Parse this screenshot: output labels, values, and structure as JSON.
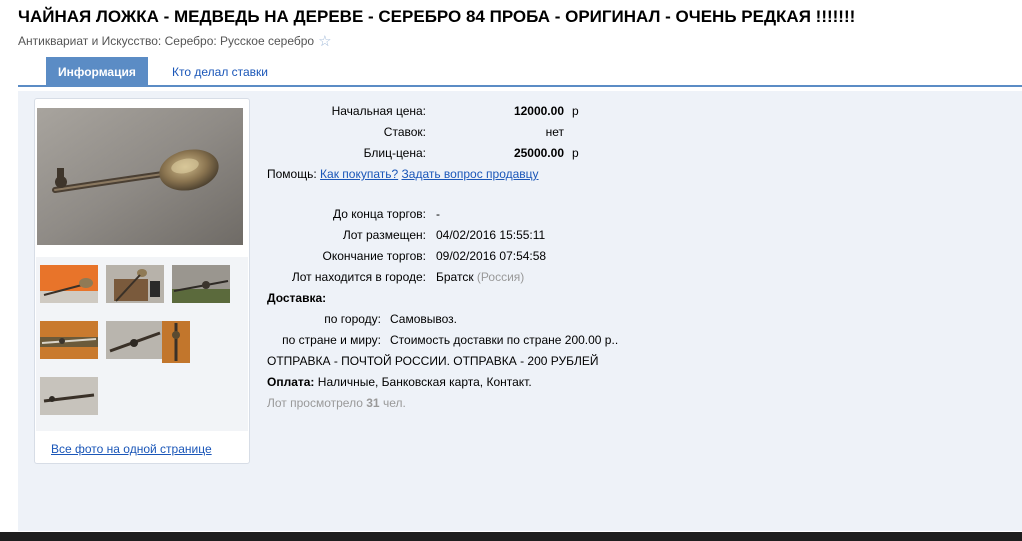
{
  "title": "ЧАЙНАЯ ЛОЖКА - МЕДВЕДЬ НА ДЕРЕВЕ - СЕРЕБРО 84 ПРОБА - ОРИГИНАЛ - ОЧЕНЬ РЕДКАЯ !!!!!!!",
  "breadcrumb": "Антиквариат и Искусство: Серебро: Русское серебро",
  "tabs": [
    {
      "label": "Информация",
      "active": true
    },
    {
      "label": "Кто делал ставки",
      "active": false
    }
  ],
  "lot": {
    "start_price_label": "Начальная цена:",
    "start_price_value": "12000.00",
    "start_price_unit": "р",
    "bids_label": "Ставок:",
    "bids_value": "нет",
    "blitz_label": "Блиц-цена:",
    "blitz_value": "25000.00",
    "blitz_unit": "р",
    "help_label": "Помощь:",
    "help_link_1": "Как покупать?",
    "help_link_2": "Задать вопрос продавцу",
    "time_left_label": "До конца торгов:",
    "time_left_value": "-",
    "posted_label": "Лот размещен:",
    "posted_value": "04/02/2016 15:55:11",
    "end_label": "Окончание торгов:",
    "end_value": "09/02/2016 07:54:58",
    "city_label": "Лот находится в городе:",
    "city_value": "Братск",
    "country_value": "(Россия)",
    "delivery_heading": "Доставка:",
    "delivery_city_label": "по городу:",
    "delivery_city_value": "Самовывоз.",
    "delivery_country_label": "по стране и миру:",
    "delivery_country_value": "Стоимость доставки по стране 200.00 р..",
    "shipping_note": "ОТПРАВКА - ПОЧТОЙ РОССИИ. ОТПРАВКА - 200 РУБЛЕЙ",
    "payment_label": "Оплата:",
    "payment_value": "Наличные, Банковская карта, Контакт.",
    "views_prefix": "Лот просмотрело",
    "views_count": "31",
    "views_suffix": "чел."
  },
  "gallery": {
    "all_photos_link": "Все фото на одной странице",
    "thumb_count": 7
  },
  "colors": {
    "accent": "#5b8cc5",
    "link": "#1a56b8",
    "panel_bg": "#eef2f8"
  }
}
